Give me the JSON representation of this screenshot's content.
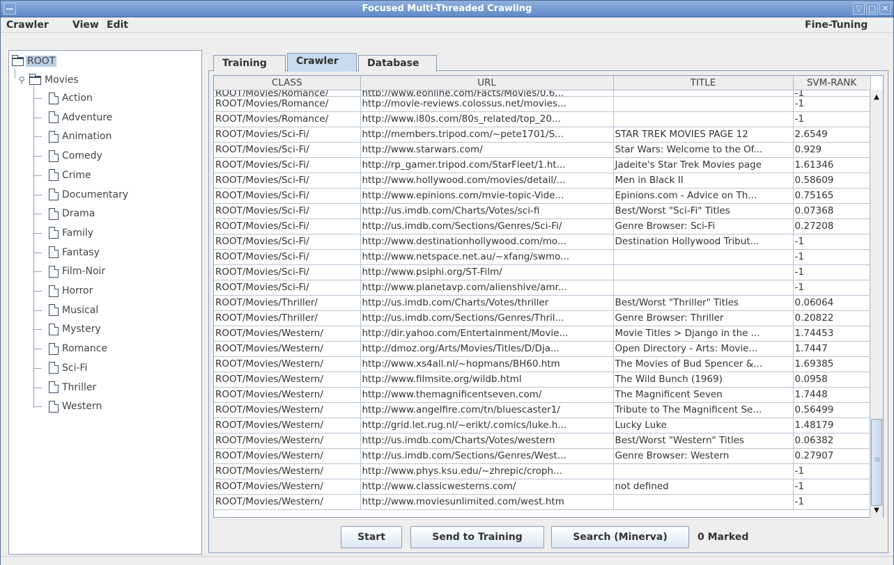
{
  "window": {
    "title": "Focused Multi-Threaded Crawling",
    "controls": [
      "▽",
      "□",
      "✕"
    ]
  },
  "menubar": {
    "items": [
      "Crawler",
      "View",
      "Edit"
    ],
    "right": "Fine-Tuning"
  },
  "tree": {
    "root": "ROOT",
    "folder": "Movies",
    "leaves": [
      "Action",
      "Adventure",
      "Animation",
      "Comedy",
      "Crime",
      "Documentary",
      "Drama",
      "Family",
      "Fantasy",
      "Film-Noir",
      "Horror",
      "Musical",
      "Mystery",
      "Romance",
      "Sci-Fi",
      "Thriller",
      "Western"
    ]
  },
  "tabs": [
    "Training",
    "Crawler",
    "Database"
  ],
  "active_tab": "Crawler",
  "table": {
    "headers": [
      "CLASS",
      "URL",
      "TITLE",
      "SVM-RANK"
    ],
    "rows": [
      [
        "ROOT/Movies/Romance/",
        "http://www.eonline.com/Facts/Movies/0,6...",
        "",
        "-1"
      ],
      [
        "ROOT/Movies/Romance/",
        "http://movie-reviews.colossus.net/movies...",
        "",
        "-1"
      ],
      [
        "ROOT/Movies/Romance/",
        "http://www.i80s.com/80s_related/top_20...",
        "",
        "-1"
      ],
      [
        "ROOT/Movies/Sci-Fi/",
        "http://members.tripod.com/~pete1701/S...",
        "STAR TREK MOVIES PAGE 12",
        "2.6549"
      ],
      [
        "ROOT/Movies/Sci-Fi/",
        "http://www.starwars.com/",
        "Star Wars: Welcome to the Of...",
        "0.929"
      ],
      [
        "ROOT/Movies/Sci-Fi/",
        "http://rp_gamer.tripod.com/StarFleet/1.ht...",
        "Jadeite's Star Trek Movies page",
        "1.61346"
      ],
      [
        "ROOT/Movies/Sci-Fi/",
        "http://www.hollywood.com/movies/detail/...",
        "Men in Black II",
        "0.58609"
      ],
      [
        "ROOT/Movies/Sci-Fi/",
        "http://www.epinions.com/mvie-topic-Vide...",
        "Epinions.com - Advice on Th...",
        "0.75165"
      ],
      [
        "ROOT/Movies/Sci-Fi/",
        "http://us.imdb.com/Charts/Votes/sci-fi",
        "Best/Worst \"Sci-Fi\" Titles",
        "0.07368"
      ],
      [
        "ROOT/Movies/Sci-Fi/",
        "http://us.imdb.com/Sections/Genres/Sci-Fi/",
        "Genre Browser: Sci-Fi",
        "0.27208"
      ],
      [
        "ROOT/Movies/Sci-Fi/",
        "http://www.destinationhollywood.com/mo...",
        "Destination Hollywood Tribut...",
        "-1"
      ],
      [
        "ROOT/Movies/Sci-Fi/",
        "http://www.netspace.net.au/~xfang/swmo...",
        "",
        "-1"
      ],
      [
        "ROOT/Movies/Sci-Fi/",
        "http://www.psiphi.org/ST-Film/",
        "",
        "-1"
      ],
      [
        "ROOT/Movies/Sci-Fi/",
        "http://www.planetavp.com/alienshive/amr...",
        "",
        "-1"
      ],
      [
        "ROOT/Movies/Thriller/",
        "http://us.imdb.com/Charts/Votes/thriller",
        "Best/Worst \"Thriller\" Titles",
        "0.06064"
      ],
      [
        "ROOT/Movies/Thriller/",
        "http://us.imdb.com/Sections/Genres/Thril...",
        "Genre Browser: Thriller",
        "0.20822"
      ],
      [
        "ROOT/Movies/Western/",
        "http://dir.yahoo.com/Entertainment/Movie...",
        "Movie Titles > Django in the ...",
        "1.74453"
      ],
      [
        "ROOT/Movies/Western/",
        "http://dmoz.org/Arts/Movies/Titles/D/Dja...",
        "Open Directory - Arts: Movie...",
        "1.7447"
      ],
      [
        "ROOT/Movies/Western/",
        "http://www.xs4all.nl/~hopmans/BH60.htm",
        "The Movies of Bud Spencer &...",
        "1.69385"
      ],
      [
        "ROOT/Movies/Western/",
        "http://www.filmsite.org/wildb.html",
        "The Wild Bunch (1969)",
        "0.0958"
      ],
      [
        "ROOT/Movies/Western/",
        "http://www.themagnificentseven.com/",
        "The Magnificent Seven",
        "1.7448"
      ],
      [
        "ROOT/Movies/Western/",
        "http://www.angelfire.com/tn/bluescaster1/",
        "Tribute to The Magnificent Se...",
        "0.56499"
      ],
      [
        "ROOT/Movies/Western/",
        "http://grid.let.rug.nl/~erikt/.comics/luke.h...",
        "Lucky Luke",
        "1.48179"
      ],
      [
        "ROOT/Movies/Western/",
        "http://us.imdb.com/Charts/Votes/western",
        "Best/Worst \"Western\" Titles",
        "0.06382"
      ],
      [
        "ROOT/Movies/Western/",
        "http://us.imdb.com/Sections/Genres/West...",
        "Genre Browser: Western",
        "0.27907"
      ],
      [
        "ROOT/Movies/Western/",
        "http://www.phys.ksu.edu/~zhrepic/croph...",
        "",
        "-1"
      ],
      [
        "ROOT/Movies/Western/",
        "http://www.classicwesterns.com/",
        "not defined",
        "-1"
      ],
      [
        "ROOT/Movies/Western/",
        "http://www.moviesunlimited.com/west.htm",
        "",
        "-1"
      ]
    ]
  },
  "buttons": {
    "start": "Start",
    "send": "Send to Training",
    "search": "Search (Minerva)"
  },
  "marked": "0 Marked",
  "colors": {
    "titlebar": "#6f96cf",
    "selection": "#b8cfe5",
    "grid": "#b9c4d2"
  }
}
